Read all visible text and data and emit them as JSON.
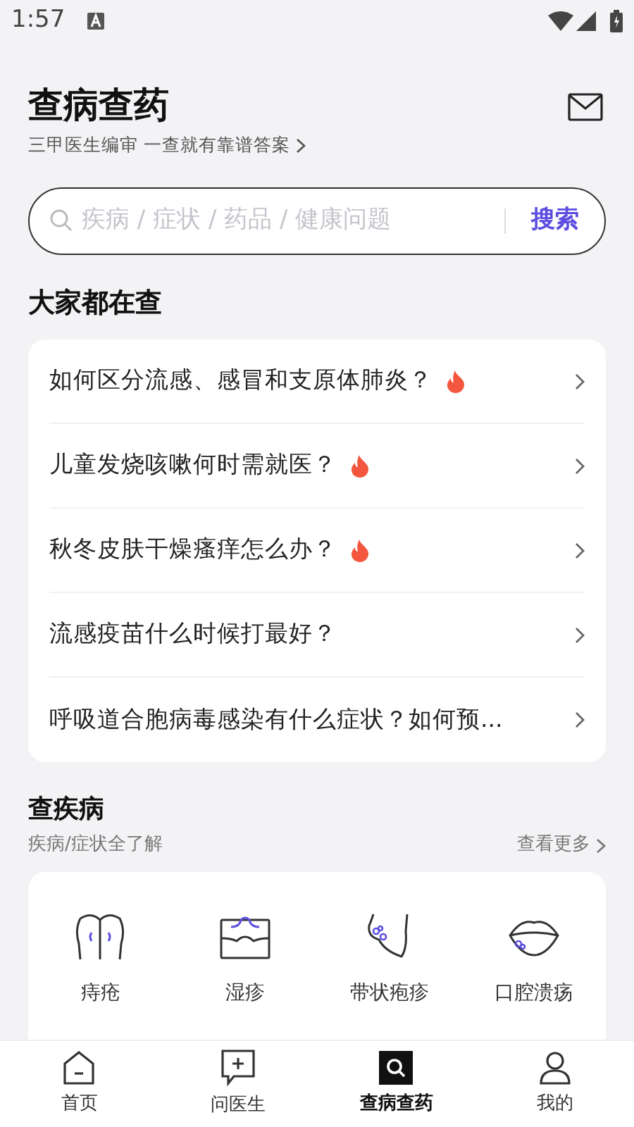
{
  "status_bar": {
    "time": "1:57"
  },
  "header": {
    "title": "查病查药",
    "subtitle": "三甲医生编审 一查就有靠谱答案"
  },
  "search": {
    "placeholder": "疾病 / 症状 / 药品 / 健康问题",
    "button": "搜索"
  },
  "trending": {
    "title": "大家都在查",
    "items": [
      {
        "text": "如何区分流感、感冒和支原体肺炎？",
        "hot": true
      },
      {
        "text": "儿童发烧咳嗽何时需就医？",
        "hot": true
      },
      {
        "text": "秋冬皮肤干燥瘙痒怎么办？",
        "hot": true
      },
      {
        "text": "流感疫苗什么时候打最好？",
        "hot": false
      },
      {
        "text": "呼吸道合胞病毒感染有什么症状？如何预...",
        "hot": false
      }
    ]
  },
  "diseases": {
    "title": "查疾病",
    "subtitle": "疾病/症状全了解",
    "more": "查看更多",
    "items": [
      {
        "label": "痔疮",
        "kind": "buttocks"
      },
      {
        "label": "湿疹",
        "kind": "skin"
      },
      {
        "label": "带状疱疹",
        "kind": "torso"
      },
      {
        "label": "口腔溃疡",
        "kind": "mouth"
      }
    ]
  },
  "bottom_nav": [
    {
      "label": "首页",
      "kind": "home",
      "selected": false
    },
    {
      "label": "问医生",
      "kind": "ask",
      "selected": false
    },
    {
      "label": "查病查药",
      "kind": "search",
      "selected": true
    },
    {
      "label": "我的",
      "kind": "me",
      "selected": false
    }
  ]
}
